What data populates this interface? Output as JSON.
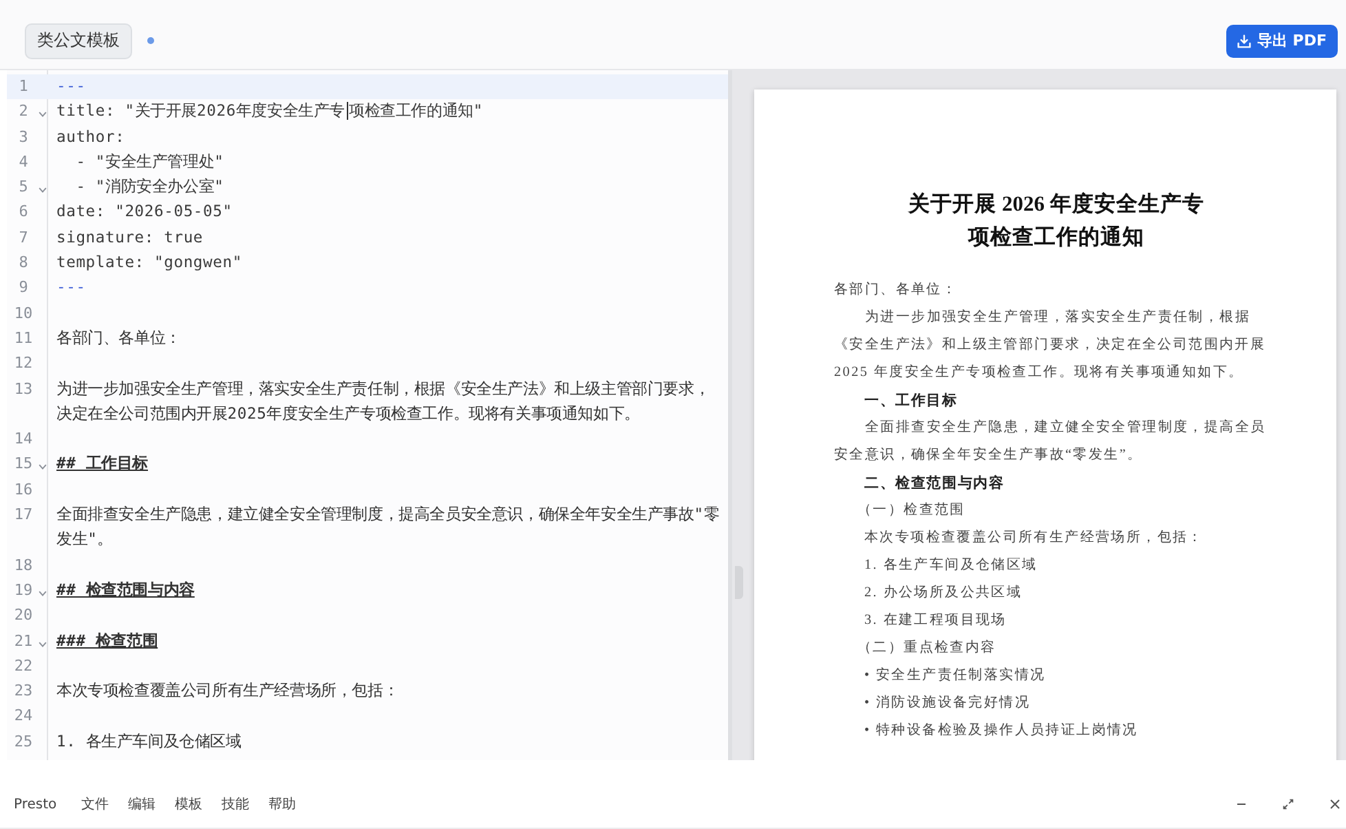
{
  "toolbar": {
    "template_button": "类公文模板",
    "modified": true,
    "export_button": "导出 PDF"
  },
  "editor": {
    "lines": [
      {
        "number": "1",
        "kind": "delimiter",
        "text": "---",
        "foldable": false,
        "current": true
      },
      {
        "number": "2",
        "kind": "yaml",
        "text": "title: \"关于开展2026年度安全生产专",
        "after_cursor": "项检查工作的通知\"",
        "foldable": true,
        "current": false
      },
      {
        "number": "3",
        "kind": "yaml",
        "text": "author:",
        "foldable": false,
        "current": false
      },
      {
        "number": "4",
        "kind": "yaml",
        "text": "  - \"安全生产管理处\"",
        "foldable": false,
        "current": false
      },
      {
        "number": "5",
        "kind": "yaml",
        "text": "  - \"消防安全办公室\"",
        "foldable": true,
        "current": false
      },
      {
        "number": "6",
        "kind": "yaml",
        "text": "date: \"2026-05-05\"",
        "foldable": false,
        "current": false
      },
      {
        "number": "7",
        "kind": "yaml",
        "text": "signature: true",
        "foldable": false,
        "current": false
      },
      {
        "number": "8",
        "kind": "yaml",
        "text": "template: \"gongwen\"",
        "foldable": false,
        "current": false
      },
      {
        "number": "9",
        "kind": "delimiter",
        "text": "---",
        "foldable": false,
        "current": false
      },
      {
        "number": "10",
        "kind": "blank",
        "foldable": false,
        "current": false
      },
      {
        "number": "11",
        "kind": "text",
        "text": "各部门、各单位：",
        "foldable": false,
        "current": false
      },
      {
        "number": "12",
        "kind": "blank",
        "foldable": false,
        "current": false
      },
      {
        "number": "13",
        "kind": "text",
        "text": "为进一步加强安全生产管理，落实安全生产责任制，根据《安全生产法》和上级主管部门要求，决定在全公司范围内开展2025年度安全生产专项检查工作。现将有关事项通知如下。",
        "foldable": false,
        "current": false
      },
      {
        "number": "14",
        "kind": "blank",
        "foldable": false,
        "current": false
      },
      {
        "number": "15",
        "kind": "heading",
        "text": "## 工作目标",
        "foldable": true,
        "current": false
      },
      {
        "number": "16",
        "kind": "blank",
        "foldable": false,
        "current": false
      },
      {
        "number": "17",
        "kind": "text",
        "text": "全面排查安全生产隐患，建立健全安全管理制度，提高全员安全意识，确保全年安全生产事故\"零发生\"。",
        "foldable": false,
        "current": false
      },
      {
        "number": "18",
        "kind": "blank",
        "foldable": false,
        "current": false
      },
      {
        "number": "19",
        "kind": "heading",
        "text": "## 检查范围与内容",
        "foldable": true,
        "current": false
      },
      {
        "number": "20",
        "kind": "blank",
        "foldable": false,
        "current": false
      },
      {
        "number": "21",
        "kind": "heading",
        "text": "### 检查范围",
        "foldable": true,
        "current": false
      },
      {
        "number": "22",
        "kind": "blank",
        "foldable": false,
        "current": false
      },
      {
        "number": "23",
        "kind": "text",
        "text": "本次专项检查覆盖公司所有生产经营场所，包括：",
        "foldable": false,
        "current": false
      },
      {
        "number": "24",
        "kind": "blank",
        "foldable": false,
        "current": false
      },
      {
        "number": "25",
        "kind": "text",
        "text": "1. 各生产车间及仓储区域",
        "foldable": false,
        "current": false
      }
    ]
  },
  "preview": {
    "title_lines": [
      "关于开展 2026 年度安全生产专",
      "项检查工作的通知"
    ],
    "blocks": [
      {
        "kind": "salutation",
        "text": "各部门、各单位："
      },
      {
        "kind": "paragraph",
        "text": "为进一步加强安全生产管理，落实安全生产责任制，根据《安全生产法》和上级主管部门要求，决定在全公司范围内开展 2025 年度安全生产专项检查工作。现将有关事项通知如下。"
      },
      {
        "kind": "heading",
        "text": "一、工作目标"
      },
      {
        "kind": "paragraph",
        "text": "全面排查安全生产隐患，建立健全安全管理制度，提高全员安全意识，确保全年安全生产事故“零发生”。"
      },
      {
        "kind": "heading",
        "text": "二、检查范围与内容"
      },
      {
        "kind": "subheading",
        "text": "（一）检查范围"
      },
      {
        "kind": "text",
        "text": "本次专项检查覆盖公司所有生产经营场所，包括："
      },
      {
        "kind": "list_item",
        "text": "1. 各生产车间及仓储区域"
      },
      {
        "kind": "list_item",
        "text": "2. 办公场所及公共区域"
      },
      {
        "kind": "list_item",
        "text": "3. 在建工程项目现场"
      },
      {
        "kind": "subheading",
        "text": "（二）重点检查内容"
      },
      {
        "kind": "bullet",
        "text": "• 安全生产责任制落实情况"
      },
      {
        "kind": "bullet",
        "text": "• 消防设施设备完好情况"
      },
      {
        "kind": "bullet",
        "text": "• 特种设备检验及操作人员持证上岗情况"
      }
    ]
  },
  "menu_bar": {
    "app_name": "Presto",
    "menus": [
      "文件",
      "编辑",
      "模板",
      "技能",
      "帮助"
    ]
  }
}
